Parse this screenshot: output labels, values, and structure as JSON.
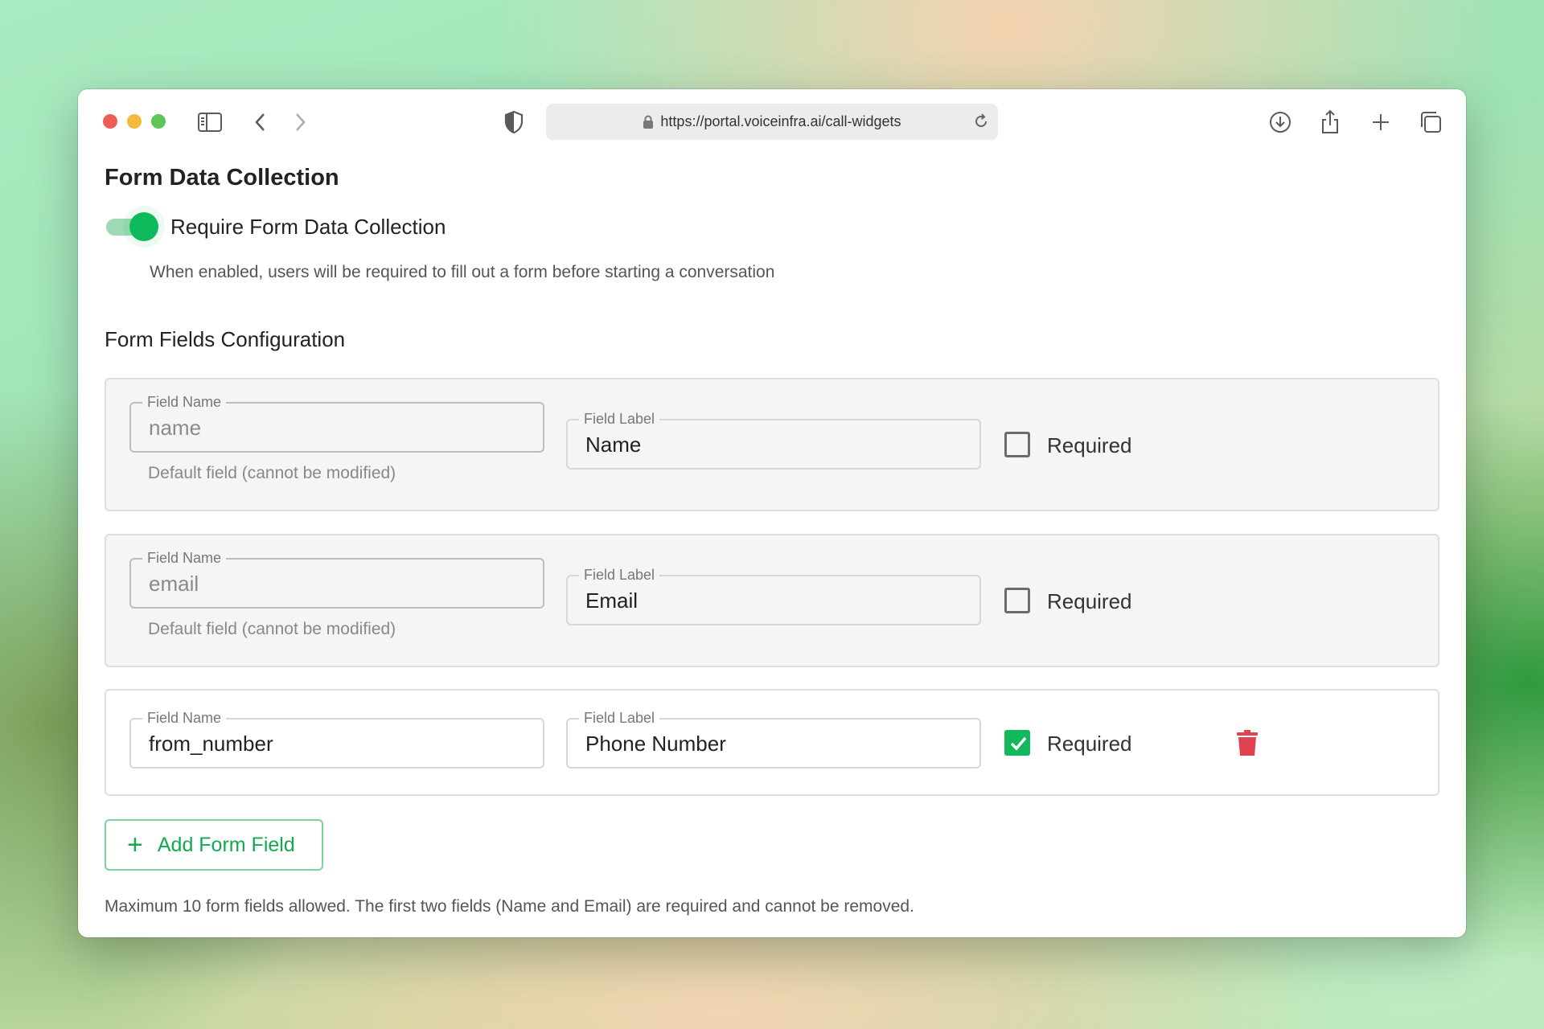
{
  "browser": {
    "url": "https://portal.voiceinfra.ai/call-widgets"
  },
  "page": {
    "title": "Form Data Collection",
    "toggle": {
      "label": "Require Form Data Collection",
      "enabled": true,
      "help": "When enabled, users will be required to fill out a form before starting a conversation"
    },
    "section_title": "Form Fields Configuration",
    "fields": [
      {
        "name_legend": "Field Name",
        "name_value": "name",
        "name_disabled": true,
        "helper": "Default field (cannot be modified)",
        "label_legend": "Field Label",
        "label_value": "Name",
        "required_label": "Required",
        "required": false
      },
      {
        "name_legend": "Field Name",
        "name_value": "email",
        "name_disabled": true,
        "helper": "Default field (cannot be modified)",
        "label_legend": "Field Label",
        "label_value": "Email",
        "required_label": "Required",
        "required": false
      },
      {
        "name_legend": "Field Name",
        "name_value": "from_number",
        "name_disabled": false,
        "helper": "",
        "label_legend": "Field Label",
        "label_value": "Phone Number",
        "required_label": "Required",
        "required": true,
        "deletable": true
      }
    ],
    "add_button": {
      "icon": "plus-icon",
      "label": "Add Form Field"
    },
    "footer_note": "Maximum 10 form fields allowed. The first two fields (Name and Email) are required and cannot be removed."
  },
  "colors": {
    "accent": "#12b85a",
    "danger": "#e0434f"
  }
}
